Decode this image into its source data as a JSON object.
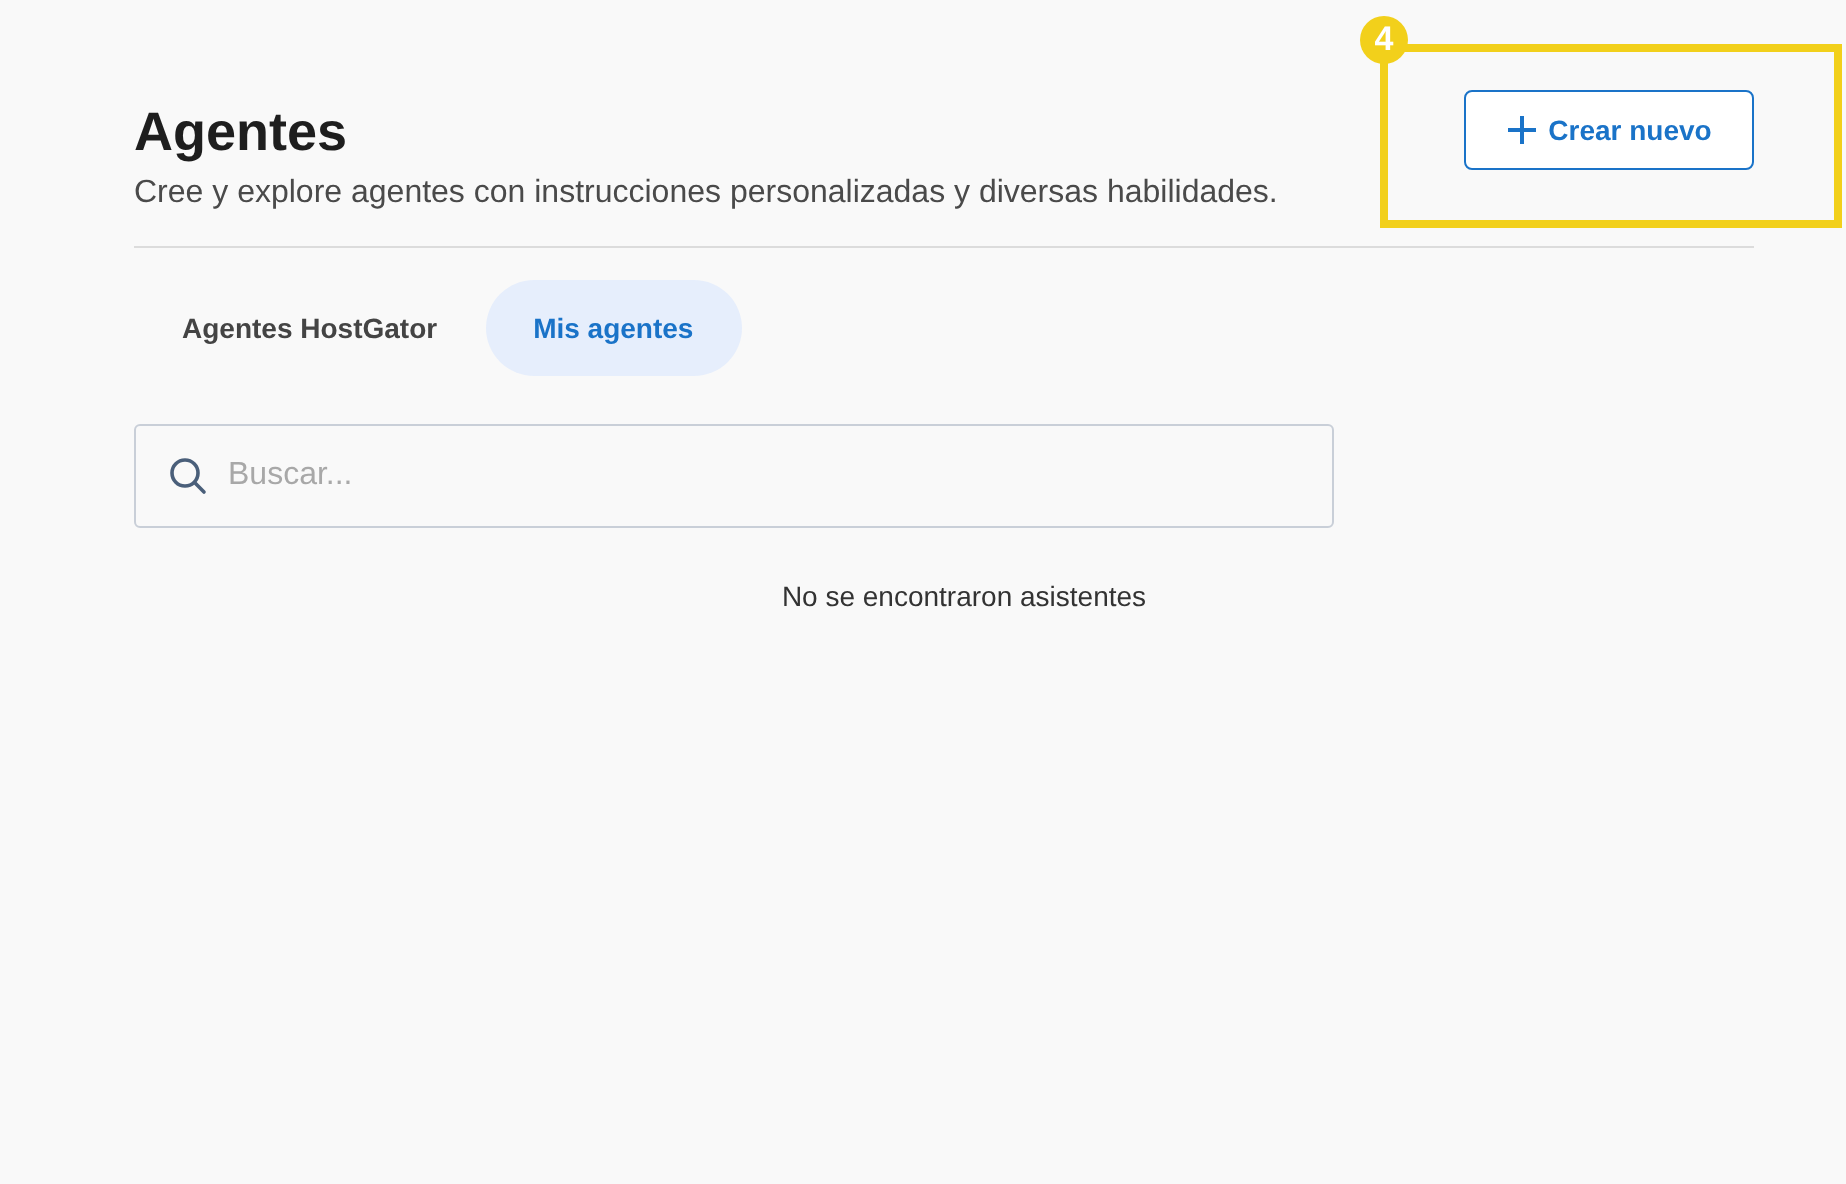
{
  "header": {
    "title": "Agentes",
    "subtitle": "Cree y explore agentes con instrucciones personalizadas y diversas habilidades.",
    "create_button": "Crear nuevo"
  },
  "tabs": [
    {
      "label": "Agentes HostGator",
      "selected": false
    },
    {
      "label": "Mis agentes",
      "selected": true
    }
  ],
  "search": {
    "placeholder": "Buscar..."
  },
  "empty_message": "No se encontraron asistentes",
  "callout": {
    "badge": "4"
  }
}
